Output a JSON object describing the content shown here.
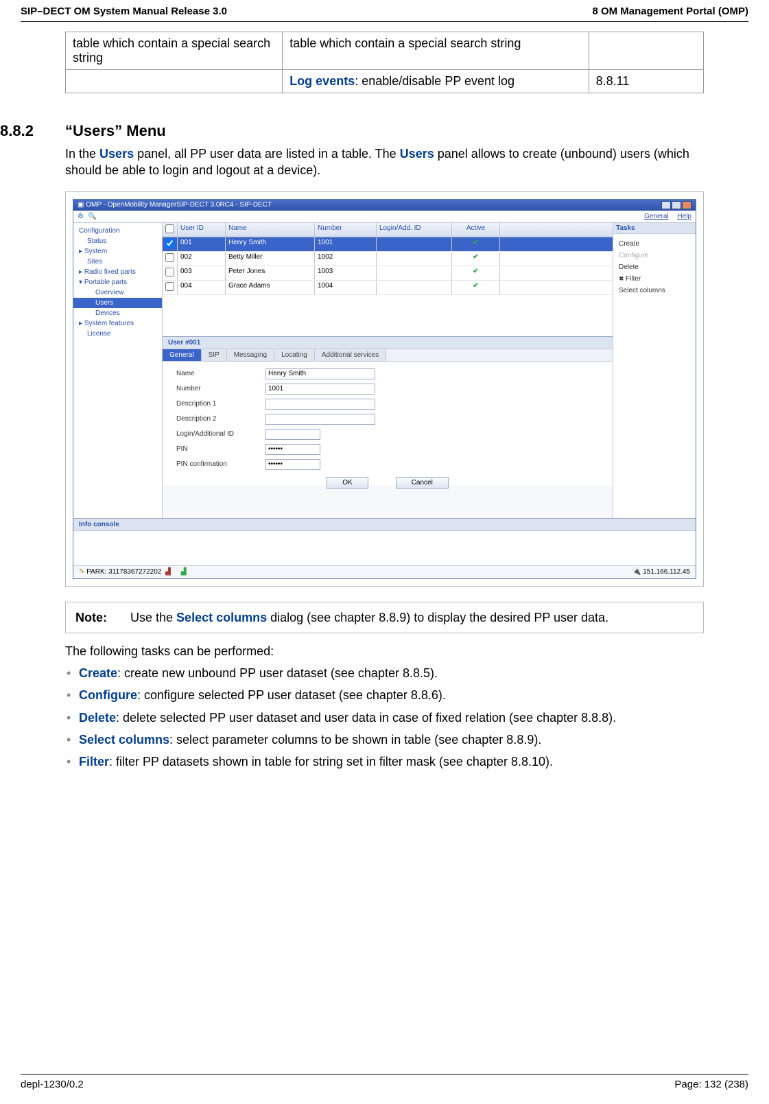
{
  "header": {
    "left": "SIP–DECT OM System Manual Release 3.0",
    "right": "8 OM Management Portal (OMP)"
  },
  "top_table": {
    "rows": [
      {
        "c1": "table which contain a special search string",
        "c2_plain": "table which contain a special search string",
        "c3": ""
      },
      {
        "c1": "",
        "c2_bold": "Log events",
        "c2_rest": ": enable/disable PP event log",
        "c3": "8.8.11"
      }
    ]
  },
  "section": {
    "number": "8.8.2",
    "title": "“Users” Menu",
    "intro_pre": "In the ",
    "intro_link1": "Users",
    "intro_mid": " panel, all PP user data are listed in a table. The ",
    "intro_link2": "Users",
    "intro_post": " panel allows to create (unbound) users (which should be able to login and logout at a device)."
  },
  "app": {
    "title": "OMP - OpenMobility ManagerSIP-DECT 3.0RC4 - SIP-DECT",
    "topnav": {
      "general": "General",
      "help": "Help"
    },
    "sidebar": {
      "head": "Configuration",
      "items": {
        "status": "Status",
        "system": "System",
        "sites": "Sites",
        "rfp": "Radio fixed parts",
        "pp": "Portable parts",
        "overview": "Overview",
        "users": "Users",
        "devices": "Devices",
        "sysfeat": "System features",
        "license": "License"
      }
    },
    "grid": {
      "headers": {
        "uid": "User ID",
        "name": "Name",
        "num": "Number",
        "login": "Login/Add. ID",
        "active": "Active"
      },
      "rows": [
        {
          "uid": "001",
          "name": "Henry Smith",
          "num": "1001",
          "login": "",
          "active": true,
          "selected": true,
          "checked": true
        },
        {
          "uid": "002",
          "name": "Betty Miller",
          "num": "1002",
          "login": "",
          "active": true
        },
        {
          "uid": "003",
          "name": "Peter Jones",
          "num": "1003",
          "login": "",
          "active": true
        },
        {
          "uid": "004",
          "name": "Grace Adams",
          "num": "1004",
          "login": "",
          "active": true
        }
      ]
    },
    "detail": {
      "title": "User #001",
      "tabs": {
        "general": "General",
        "sip": "SIP",
        "messaging": "Messaging",
        "locating": "Locating",
        "additional": "Additional services"
      },
      "form": {
        "name_label": "Name",
        "name_value": "Henry Smith",
        "number_label": "Number",
        "number_value": "1001",
        "desc1_label": "Description 1",
        "desc1_value": "",
        "desc2_label": "Description 2",
        "desc2_value": "",
        "login_label": "Login/Additional ID",
        "login_value": "",
        "pin_label": "PIN",
        "pin_value": "••••••",
        "pinc_label": "PIN confirmation",
        "pinc_value": "••••••",
        "ok": "OK",
        "cancel": "Cancel"
      }
    },
    "tasks": {
      "header": "Tasks",
      "create": "Create",
      "configure": "Configure",
      "delete": "Delete",
      "filter": "Filter",
      "select_columns": "Select columns"
    },
    "info_console": "Info console",
    "status": {
      "park": "PARK: 31178367272202",
      "ip": "151.166.112.45"
    }
  },
  "note": {
    "label": "Note:",
    "pre": "Use the ",
    "link": "Select columns",
    "post": " dialog (see chapter 8.8.9) to display the desired PP user data."
  },
  "tasks_intro": "The following tasks can be performed:",
  "tasks_list": [
    {
      "kw": "Create",
      "rest": ": create new unbound PP user dataset (see chapter 8.8.5)."
    },
    {
      "kw": "Configure",
      "rest": ": configure selected PP user dataset (see chapter 8.8.6)."
    },
    {
      "kw": "Delete",
      "rest": ": delete selected PP user dataset and user data in case of fixed relation (see chapter 8.8.8)."
    },
    {
      "kw": "Select columns",
      "rest": ": select parameter columns to be shown in table (see chapter 8.8.9)."
    },
    {
      "kw": "Filter",
      "rest": ": filter PP datasets shown in table for string set in filter mask (see chapter 8.8.10)."
    }
  ],
  "footer": {
    "left": "depl-1230/0.2",
    "right": "Page: 132 (238)"
  }
}
